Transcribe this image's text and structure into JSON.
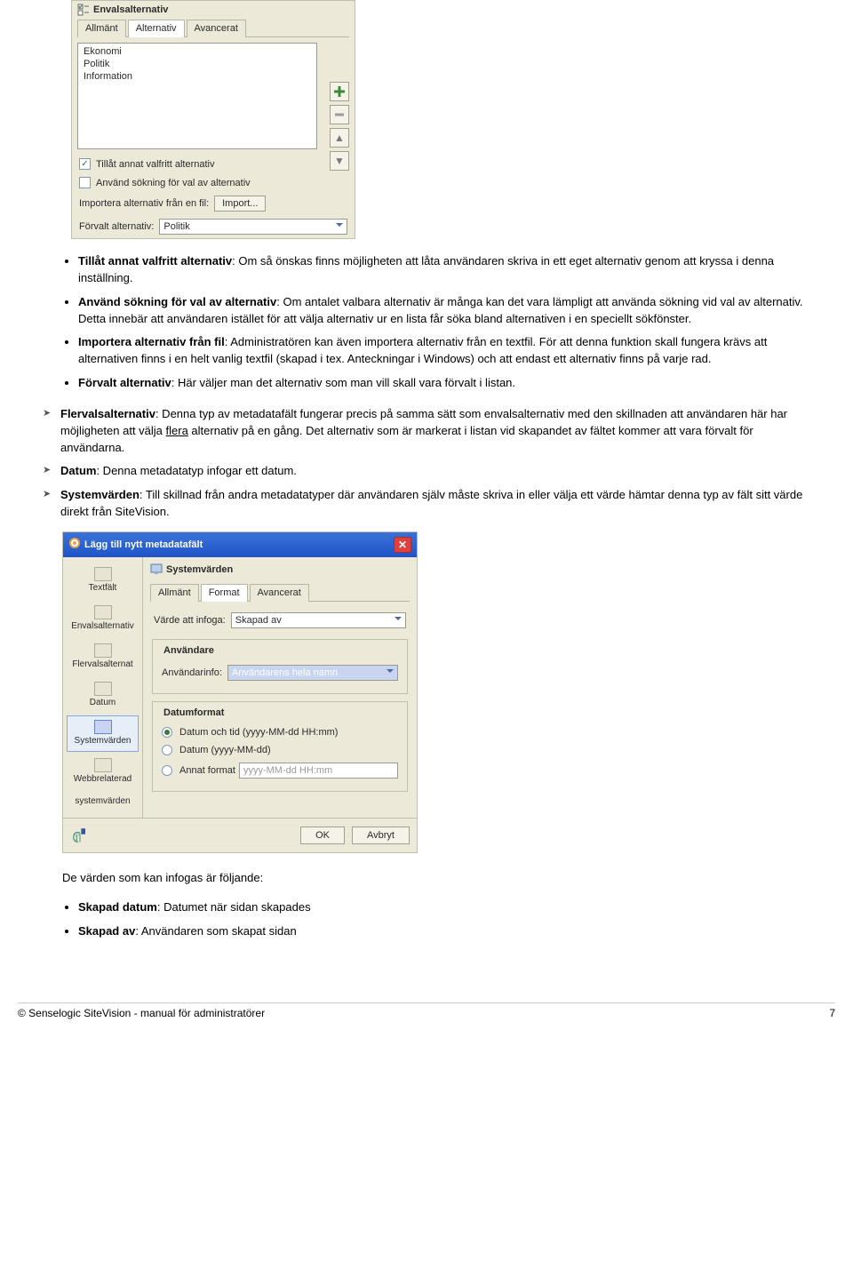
{
  "dialog1": {
    "title": "Envalsalternativ",
    "tabs": [
      "Allmänt",
      "Alternativ",
      "Avancerat"
    ],
    "active_tab": 1,
    "list_items": [
      "Ekonomi",
      "Politik",
      "Information"
    ],
    "checkbox1_label": "Tillåt annat valfritt alternativ",
    "checkbox2_label": "Använd sökning för val av alternativ",
    "import_label": "Importera alternativ från en fil:",
    "import_button": "Import...",
    "default_label": "Förvalt alternativ:",
    "default_value": "Politik"
  },
  "bullets": [
    {
      "term": "Tillåt annat valfritt alternativ",
      "text": ": Om så önskas finns möjligheten att låta användaren skriva in ett eget alternativ genom att kryssa i denna inställning."
    },
    {
      "term": "Använd sökning för val av alternativ",
      "text": ": Om antalet valbara alternativ är många kan det vara lämpligt att använda sökning vid val av alternativ. Detta innebär att användaren istället för att välja alternativ ur en lista får söka bland alternativen i en speciellt sökfönster."
    },
    {
      "term": "Importera alternativ från fil",
      "text": ": Administratören kan även importera alternativ från en textfil. För att denna funktion skall fungera krävs att alternativen finns i en helt vanlig textfil (skapad i tex. Anteckningar i Windows) och att endast ett alternativ finns på varje rad."
    },
    {
      "term": "Förvalt alternativ",
      "text": ": Här väljer man det alternativ som man vill skall vara förvalt i listan."
    }
  ],
  "arrows": [
    {
      "term": "Flervalsalternativ",
      "text": ": Denna typ av metadatafält fungerar precis på samma sätt som envalsalternativ med den skillnaden att användaren här har möjligheten att välja ",
      "underline": "flera",
      "text2": " alternativ på en gång. Det alternativ som är markerat i listan vid skapandet av fältet kommer att vara förvalt för användarna."
    },
    {
      "term": "Datum",
      "text": ": Denna metadatatyp infogar ett datum."
    },
    {
      "term": "Systemvärden",
      "text": ": Till skillnad från andra metadatatyper där användaren själv måste skriva in eller välja ett värde hämtar denna typ av fält sitt värde direkt från SiteVision."
    }
  ],
  "dialog2": {
    "window_title": "Lägg till nytt metadatafält",
    "title": "Systemvärden",
    "sidebar": [
      "Textfält",
      "Envalsalternativ",
      "Flervalsalternat",
      "Datum",
      "Systemvärden",
      "Webbrelaterad",
      "systemvärden"
    ],
    "selected_sidebar": 4,
    "tabs": [
      "Allmänt",
      "Format",
      "Avancerat"
    ],
    "active_tab": 1,
    "insert_label": "Värde att infoga:",
    "insert_value": "Skapad av",
    "group_user": "Användare",
    "userinfo_label": "Användarinfo:",
    "userinfo_value": "Användarens hela namn",
    "group_date": "Datumformat",
    "radio1": "Datum och tid (yyyy-MM-dd HH:mm)",
    "radio2": "Datum (yyyy-MM-dd)",
    "radio3": "Annat format",
    "custom_format_placeholder": "yyyy-MM-dd HH:mm",
    "ok": "OK",
    "cancel": "Avbryt"
  },
  "after_text": "De värden som kan infogas är följande:",
  "after_bullets": [
    {
      "term": "Skapad datum",
      "text": ":  Datumet när sidan skapades"
    },
    {
      "term": "Skapad av",
      "text": ":  Användaren som skapat sidan"
    }
  ],
  "footer": {
    "left": "© Senselogic SiteVision - manual för administratörer",
    "right": "7"
  }
}
